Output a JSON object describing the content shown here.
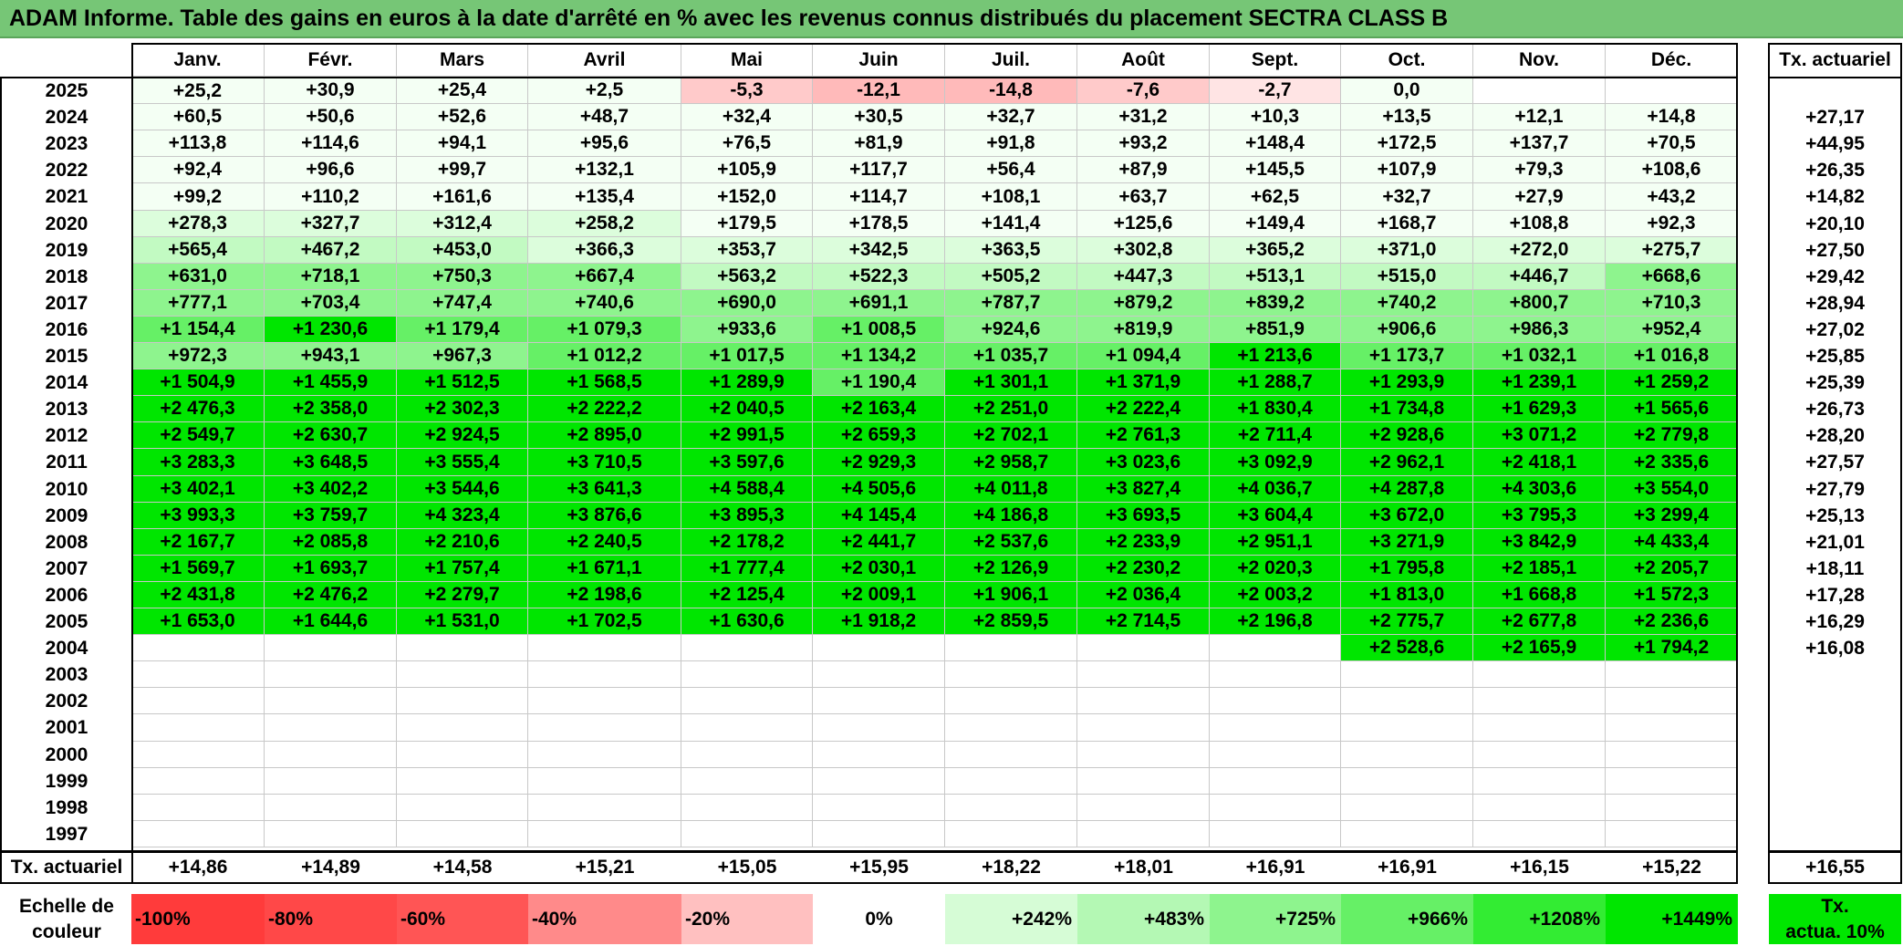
{
  "title": "ADAM Informe. Table des gains en euros à la date d'arrêté en % avec les revenus connus distribués du placement SECTRA CLASS B",
  "months": [
    "Janv.",
    "Févr.",
    "Mars",
    "Avril",
    "Mai",
    "Juin",
    "Juil.",
    "Août",
    "Sept.",
    "Oct.",
    "Nov.",
    "Déc."
  ],
  "tx_actuariel_header": "Tx. actuariel",
  "rows": [
    {
      "year": "2025",
      "values": [
        "+25,2",
        "+30,9",
        "+25,4",
        "+2,5",
        "-5,3",
        "-12,1",
        "-14,8",
        "-7,6",
        "-2,7",
        "0,0",
        "",
        ""
      ],
      "tx": ""
    },
    {
      "year": "2024",
      "values": [
        "+60,5",
        "+50,6",
        "+52,6",
        "+48,7",
        "+32,4",
        "+30,5",
        "+32,7",
        "+31,2",
        "+10,3",
        "+13,5",
        "+12,1",
        "+14,8"
      ],
      "tx": "+27,17"
    },
    {
      "year": "2023",
      "values": [
        "+113,8",
        "+114,6",
        "+94,1",
        "+95,6",
        "+76,5",
        "+81,9",
        "+91,8",
        "+93,2",
        "+148,4",
        "+172,5",
        "+137,7",
        "+70,5"
      ],
      "tx": "+44,95"
    },
    {
      "year": "2022",
      "values": [
        "+92,4",
        "+96,6",
        "+99,7",
        "+132,1",
        "+105,9",
        "+117,7",
        "+56,4",
        "+87,9",
        "+145,5",
        "+107,9",
        "+79,3",
        "+108,6"
      ],
      "tx": "+26,35"
    },
    {
      "year": "2021",
      "values": [
        "+99,2",
        "+110,2",
        "+161,6",
        "+135,4",
        "+152,0",
        "+114,7",
        "+108,1",
        "+63,7",
        "+62,5",
        "+32,7",
        "+27,9",
        "+43,2"
      ],
      "tx": "+14,82"
    },
    {
      "year": "2020",
      "values": [
        "+278,3",
        "+327,7",
        "+312,4",
        "+258,2",
        "+179,5",
        "+178,5",
        "+141,4",
        "+125,6",
        "+149,4",
        "+168,7",
        "+108,8",
        "+92,3"
      ],
      "tx": "+20,10"
    },
    {
      "year": "2019",
      "values": [
        "+565,4",
        "+467,2",
        "+453,0",
        "+366,3",
        "+353,7",
        "+342,5",
        "+363,5",
        "+302,8",
        "+365,2",
        "+371,0",
        "+272,0",
        "+275,7"
      ],
      "tx": "+27,50"
    },
    {
      "year": "2018",
      "values": [
        "+631,0",
        "+718,1",
        "+750,3",
        "+667,4",
        "+563,2",
        "+522,3",
        "+505,2",
        "+447,3",
        "+513,1",
        "+515,0",
        "+446,7",
        "+668,6"
      ],
      "tx": "+29,42"
    },
    {
      "year": "2017",
      "values": [
        "+777,1",
        "+703,4",
        "+747,4",
        "+740,6",
        "+690,0",
        "+691,1",
        "+787,7",
        "+879,2",
        "+839,2",
        "+740,2",
        "+800,7",
        "+710,3"
      ],
      "tx": "+28,94"
    },
    {
      "year": "2016",
      "values": [
        "+1 154,4",
        "+1 230,6",
        "+1 179,4",
        "+1 079,3",
        "+933,6",
        "+1 008,5",
        "+924,6",
        "+819,9",
        "+851,9",
        "+906,6",
        "+986,3",
        "+952,4"
      ],
      "tx": "+27,02"
    },
    {
      "year": "2015",
      "values": [
        "+972,3",
        "+943,1",
        "+967,3",
        "+1 012,2",
        "+1 017,5",
        "+1 134,2",
        "+1 035,7",
        "+1 094,4",
        "+1 213,6",
        "+1 173,7",
        "+1 032,1",
        "+1 016,8"
      ],
      "tx": "+25,85"
    },
    {
      "year": "2014",
      "values": [
        "+1 504,9",
        "+1 455,9",
        "+1 512,5",
        "+1 568,5",
        "+1 289,9",
        "+1 190,4",
        "+1 301,1",
        "+1 371,9",
        "+1 288,7",
        "+1 293,9",
        "+1 239,1",
        "+1 259,2"
      ],
      "tx": "+25,39"
    },
    {
      "year": "2013",
      "values": [
        "+2 476,3",
        "+2 358,0",
        "+2 302,3",
        "+2 222,2",
        "+2 040,5",
        "+2 163,4",
        "+2 251,0",
        "+2 222,4",
        "+1 830,4",
        "+1 734,8",
        "+1 629,3",
        "+1 565,6"
      ],
      "tx": "+26,73"
    },
    {
      "year": "2012",
      "values": [
        "+2 549,7",
        "+2 630,7",
        "+2 924,5",
        "+2 895,0",
        "+2 991,5",
        "+2 659,3",
        "+2 702,1",
        "+2 761,3",
        "+2 711,4",
        "+2 928,6",
        "+3 071,2",
        "+2 779,8"
      ],
      "tx": "+28,20"
    },
    {
      "year": "2011",
      "values": [
        "+3 283,3",
        "+3 648,5",
        "+3 555,4",
        "+3 710,5",
        "+3 597,6",
        "+2 929,3",
        "+2 958,7",
        "+3 023,6",
        "+3 092,9",
        "+2 962,1",
        "+2 418,1",
        "+2 335,6"
      ],
      "tx": "+27,57"
    },
    {
      "year": "2010",
      "values": [
        "+3 402,1",
        "+3 402,2",
        "+3 544,6",
        "+3 641,3",
        "+4 588,4",
        "+4 505,6",
        "+4 011,8",
        "+3 827,4",
        "+4 036,7",
        "+4 287,8",
        "+4 303,6",
        "+3 554,0"
      ],
      "tx": "+27,79"
    },
    {
      "year": "2009",
      "values": [
        "+3 993,3",
        "+3 759,7",
        "+4 323,4",
        "+3 876,6",
        "+3 895,3",
        "+4 145,4",
        "+4 186,8",
        "+3 693,5",
        "+3 604,4",
        "+3 672,0",
        "+3 795,3",
        "+3 299,4"
      ],
      "tx": "+25,13"
    },
    {
      "year": "2008",
      "values": [
        "+2 167,7",
        "+2 085,8",
        "+2 210,6",
        "+2 240,5",
        "+2 178,2",
        "+2 441,7",
        "+2 537,6",
        "+2 233,9",
        "+2 951,1",
        "+3 271,9",
        "+3 842,9",
        "+4 433,4"
      ],
      "tx": "+21,01"
    },
    {
      "year": "2007",
      "values": [
        "+1 569,7",
        "+1 693,7",
        "+1 757,4",
        "+1 671,1",
        "+1 777,4",
        "+2 030,1",
        "+2 126,9",
        "+2 230,2",
        "+2 020,3",
        "+1 795,8",
        "+2 185,1",
        "+2 205,7"
      ],
      "tx": "+18,11"
    },
    {
      "year": "2006",
      "values": [
        "+2 431,8",
        "+2 476,2",
        "+2 279,7",
        "+2 198,6",
        "+2 125,4",
        "+2 009,1",
        "+1 906,1",
        "+2 036,4",
        "+2 003,2",
        "+1 813,0",
        "+1 668,8",
        "+1 572,3"
      ],
      "tx": "+17,28"
    },
    {
      "year": "2005",
      "values": [
        "+1 653,0",
        "+1 644,6",
        "+1 531,0",
        "+1 702,5",
        "+1 630,6",
        "+1 918,2",
        "+2 859,5",
        "+2 714,5",
        "+2 196,8",
        "+2 775,7",
        "+2 677,8",
        "+2 236,6"
      ],
      "tx": "+16,29"
    },
    {
      "year": "2004",
      "values": [
        "",
        "",
        "",
        "",
        "",
        "",
        "",
        "",
        "",
        "+2 528,6",
        "+2 165,9",
        "+1 794,2"
      ],
      "tx": "+16,08"
    },
    {
      "year": "2003",
      "values": [
        "",
        "",
        "",
        "",
        "",
        "",
        "",
        "",
        "",
        "",
        "",
        ""
      ],
      "tx": ""
    },
    {
      "year": "2002",
      "values": [
        "",
        "",
        "",
        "",
        "",
        "",
        "",
        "",
        "",
        "",
        "",
        ""
      ],
      "tx": ""
    },
    {
      "year": "2001",
      "values": [
        "",
        "",
        "",
        "",
        "",
        "",
        "",
        "",
        "",
        "",
        "",
        ""
      ],
      "tx": ""
    },
    {
      "year": "2000",
      "values": [
        "",
        "",
        "",
        "",
        "",
        "",
        "",
        "",
        "",
        "",
        "",
        ""
      ],
      "tx": ""
    },
    {
      "year": "1999",
      "values": [
        "",
        "",
        "",
        "",
        "",
        "",
        "",
        "",
        "",
        "",
        "",
        ""
      ],
      "tx": ""
    },
    {
      "year": "1998",
      "values": [
        "",
        "",
        "",
        "",
        "",
        "",
        "",
        "",
        "",
        "",
        "",
        ""
      ],
      "tx": ""
    },
    {
      "year": "1997",
      "values": [
        "",
        "",
        "",
        "",
        "",
        "",
        "",
        "",
        "",
        "",
        "",
        ""
      ],
      "tx": ""
    }
  ],
  "footer": {
    "label": "Tx. actuariel",
    "values": [
      "+14,86",
      "+14,89",
      "+14,58",
      "+15,21",
      "+15,05",
      "+15,95",
      "+18,22",
      "+18,01",
      "+16,91",
      "+16,91",
      "+16,15",
      "+15,22"
    ],
    "total": "+16,55"
  },
  "legend": {
    "label": "Echelle de couleur",
    "label_line1": "Echelle de",
    "label_line2": "couleur",
    "scale": [
      {
        "text": "-100%",
        "color": "#ff3b3b"
      },
      {
        "text": "-80%",
        "color": "#ff4848"
      },
      {
        "text": "-60%",
        "color": "#ff5555"
      },
      {
        "text": "-40%",
        "color": "#ff8a8a"
      },
      {
        "text": "-20%",
        "color": "#ffc0c0"
      },
      {
        "text": "0%",
        "color": "#ffffff"
      },
      {
        "text": "+242%",
        "color": "#d6fcd6"
      },
      {
        "text": "+483%",
        "color": "#b4f8b4"
      },
      {
        "text": "+725%",
        "color": "#8ef48e"
      },
      {
        "text": "+966%",
        "color": "#66f066"
      },
      {
        "text": "+1208%",
        "color": "#33ec33"
      },
      {
        "text": "+1449%",
        "color": "#00e600"
      }
    ],
    "tx_label_line1": "Tx.",
    "tx_label_line2": "actua. 10%",
    "tx_color": "#00e600"
  },
  "colors": {
    "title_bg": "#76c676",
    "neg_light": "#ffe4e4",
    "neg_mid": "#ffcaca",
    "neg_strong": "#ffbaba",
    "pos_scale": [
      "#f4fff4",
      "#dcfddc",
      "#c2fac2",
      "#8ef48e",
      "#66f066",
      "#00e600"
    ]
  }
}
